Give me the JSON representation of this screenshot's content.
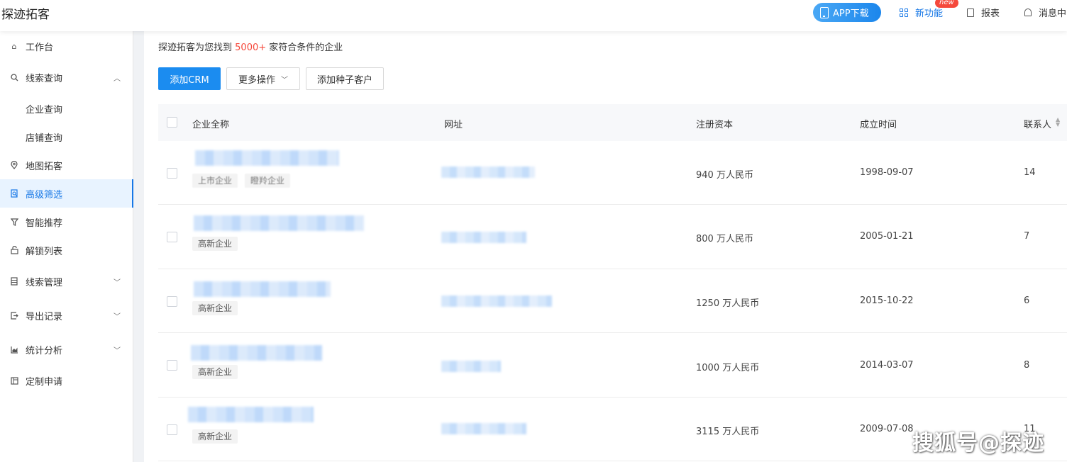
{
  "header": {
    "logo": "探迹拓客",
    "app_download": "APP下载",
    "new_feature": "新功能",
    "new_badge": "new",
    "report": "报表",
    "messages": "消息中"
  },
  "sidebar": {
    "items": [
      {
        "label": "工作台",
        "icon": "home-icon"
      },
      {
        "label": "线索查询",
        "icon": "search-icon",
        "arrow": "up"
      },
      {
        "label": "企业查询",
        "sub": true
      },
      {
        "label": "店铺查询",
        "sub": true
      },
      {
        "label": "地图拓客",
        "icon": "map-pin-icon"
      },
      {
        "label": "高级筛选",
        "icon": "advanced-filter-icon",
        "active": true
      },
      {
        "label": "智能推荐",
        "icon": "funnel-icon"
      },
      {
        "label": "解锁列表",
        "icon": "unlock-icon"
      },
      {
        "label": "线索管理",
        "icon": "list-icon",
        "arrow": "down"
      },
      {
        "label": "导出记录",
        "icon": "export-icon",
        "arrow": "down"
      },
      {
        "label": "统计分析",
        "icon": "chart-icon",
        "arrow": "down"
      },
      {
        "label": "定制申请",
        "icon": "layout-icon"
      }
    ]
  },
  "summary": {
    "prefix": "探迹拓客为您找到",
    "count": "5000+",
    "suffix": "家符合条件的企业"
  },
  "actions": {
    "add_crm": "添加CRM",
    "more": "更多操作",
    "add_seed": "添加种子客户"
  },
  "table": {
    "columns": [
      "企业全称",
      "网址",
      "注册资本",
      "成立时间",
      "联系人"
    ],
    "rows": [
      {
        "tags": [
          "上市企业",
          "瞪羚企业"
        ],
        "capital": "940 万人民币",
        "date": "1998-09-07",
        "contacts": "14"
      },
      {
        "tags": [
          "高新企业"
        ],
        "capital": "800 万人民币",
        "date": "2005-01-21",
        "contacts": "7"
      },
      {
        "tags": [
          "高新企业"
        ],
        "capital": "1250 万人民币",
        "date": "2015-10-22",
        "contacts": "6"
      },
      {
        "tags": [
          "高新企业"
        ],
        "capital": "1000 万人民币",
        "date": "2014-03-07",
        "contacts": "8"
      },
      {
        "tags": [
          "高新企业"
        ],
        "capital": "3115 万人民币",
        "date": "2009-07-08",
        "contacts": "11"
      }
    ]
  },
  "watermark": "搜狐号@探迹"
}
